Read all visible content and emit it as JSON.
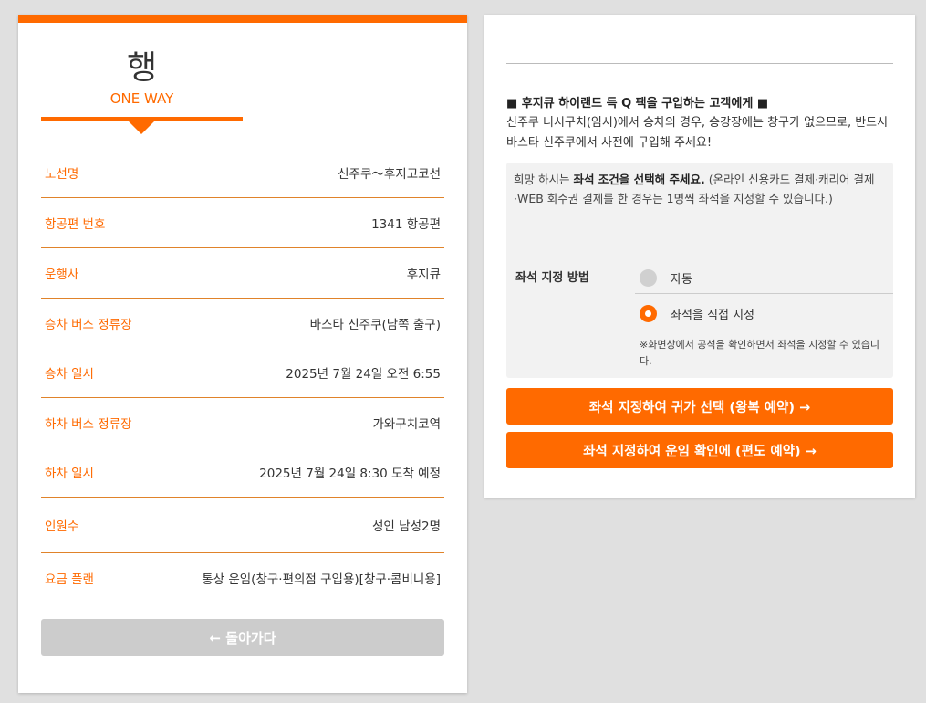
{
  "left": {
    "heading": "행",
    "subheading": "ONE WAY",
    "rows": [
      {
        "label": "노선명",
        "value": "신주쿠～후지고코선"
      },
      {
        "label": "항공편 번호",
        "value": "1341 항공편"
      },
      {
        "label": "운행사",
        "value": "후지큐"
      },
      {
        "label": "승차 버스 정류장",
        "value": "바스타 신주쿠(남쪽 출구)"
      },
      {
        "label": "승차 일시",
        "value": "2025년 7월 24일 오전 6:55"
      },
      {
        "label": "하차 버스 정류장",
        "value": "가와구치코역"
      },
      {
        "label": "하차 일시",
        "value": "2025년 7월 24일 8:30 도착 예정"
      },
      {
        "label": "인원수",
        "value": "성인 남성2명"
      },
      {
        "label": "요금 플랜",
        "value": "통상 운임(창구·편의점 구입용)[창구·콤비니용]"
      }
    ],
    "back_button": "← 돌아가다"
  },
  "right": {
    "notice_title": "■ 후지큐 하이랜드 득 Q 팩을 구입하는 고객에게 ■",
    "notice_body": "신주쿠 니시구치(임시)에서 승차의 경우, 승강장에는 창구가 없으므로, 반드시 바스타 신주쿠에서 사전에 구입해 주세요!",
    "seat_desc_prefix": "희망 하시는 ",
    "seat_desc_bold": "좌석 조건을 선택해 주세요.",
    "seat_desc_suffix": " (온라인 신용카드 결제·캐리어 결제·WEB 회수권 결제를 한 경우는 1명씩 좌석을 지정할 수 있습니다.)",
    "seat_label": "좌석 지정 방법",
    "option_auto": "자동",
    "option_manual": "좌석을 직접 지정",
    "seat_note": "※화면상에서 공석을 확인하면서 좌석을 지정할 수 있습니다.",
    "btn_roundtrip": "좌석 지정하여 귀가 선택 (왕복 예약) →",
    "btn_oneway": "좌석 지정하여 운임 확인에 (편도 예약) →",
    "selected_option": "manual"
  },
  "colors": {
    "accent": "#ff6a00",
    "disabled": "#cccccc",
    "background": "#e0e0e0"
  }
}
